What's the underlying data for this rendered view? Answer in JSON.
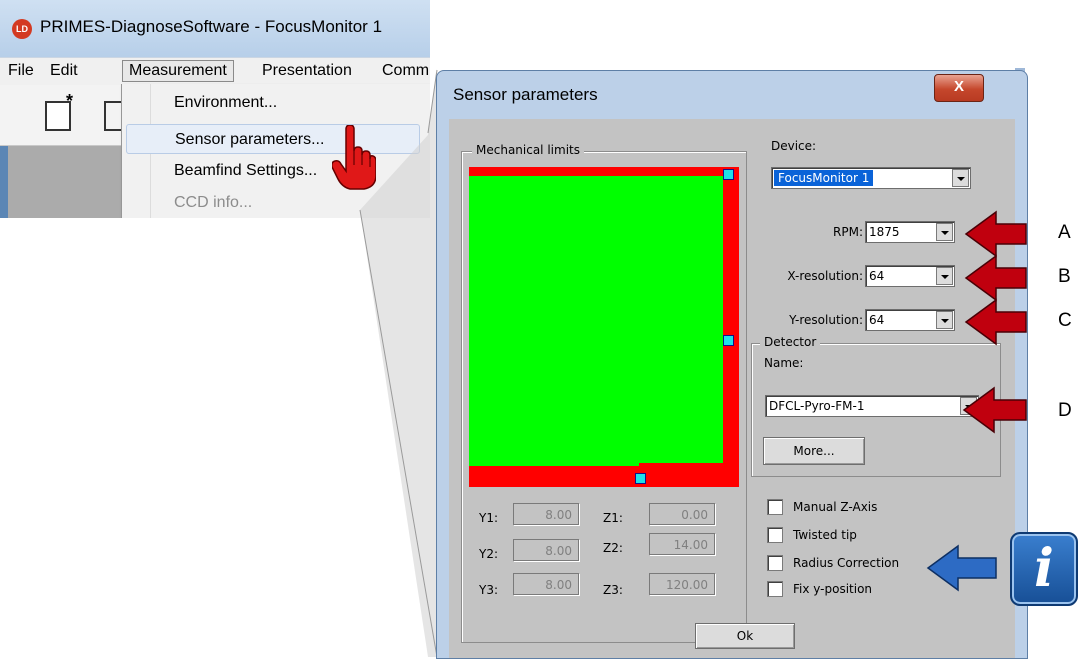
{
  "main_window": {
    "title": "PRIMES-DiagnoseSoftware - FocusMonitor 1",
    "logo_text": "LD",
    "menu": [
      "File",
      "Edit",
      "Measurement",
      "Presentation",
      "Comm"
    ],
    "dropdown_items": [
      {
        "label": "Environment...",
        "enabled": true
      },
      {
        "label": "Sensor parameters...",
        "enabled": true,
        "highlighted": true
      },
      {
        "label": "Beamfind Settings...",
        "enabled": true
      },
      {
        "label": "CCD info...",
        "enabled": false
      }
    ],
    "toolbar_icons": [
      "new-document-icon",
      "open-icon"
    ]
  },
  "dialog": {
    "title": "Sensor parameters",
    "close_label": "X",
    "mechanical_limits": {
      "legend": "Mechanical limits",
      "fields": [
        {
          "label": "Y1:",
          "value": "8.00"
        },
        {
          "label": "Z1:",
          "value": "0.00"
        },
        {
          "label": "Y2:",
          "value": "8.00"
        },
        {
          "label": "Z2:",
          "value": "14.00"
        },
        {
          "label": "Y3:",
          "value": "8.00"
        },
        {
          "label": "Z3:",
          "value": "120.00"
        }
      ]
    },
    "device": {
      "label": "Device:",
      "value": "FocusMonitor 1"
    },
    "rpm": {
      "label": "RPM:",
      "value": "1875"
    },
    "x_resolution": {
      "label": "X-resolution:",
      "value": "64"
    },
    "y_resolution": {
      "label": "Y-resolution:",
      "value": "64"
    },
    "detector": {
      "legend": "Detector",
      "name_label": "Name:",
      "name_value": "DFCL-Pyro-FM-1",
      "more_button": "More..."
    },
    "checkboxes": [
      {
        "label": "Manual Z-Axis",
        "checked": false
      },
      {
        "label": "Twisted tip",
        "checked": false
      },
      {
        "label": "Radius Correction",
        "checked": false
      },
      {
        "label": "Fix y-position",
        "checked": false
      }
    ],
    "ok_button": "Ok"
  },
  "annotations": {
    "letters": [
      "A",
      "B",
      "C",
      "D"
    ],
    "info_icon": "i",
    "colors": {
      "red_arrow": "#c0000e",
      "blue_arrow": "#2d6bc4",
      "mech_green": "#00ff00",
      "mech_red": "#ff0000"
    }
  }
}
